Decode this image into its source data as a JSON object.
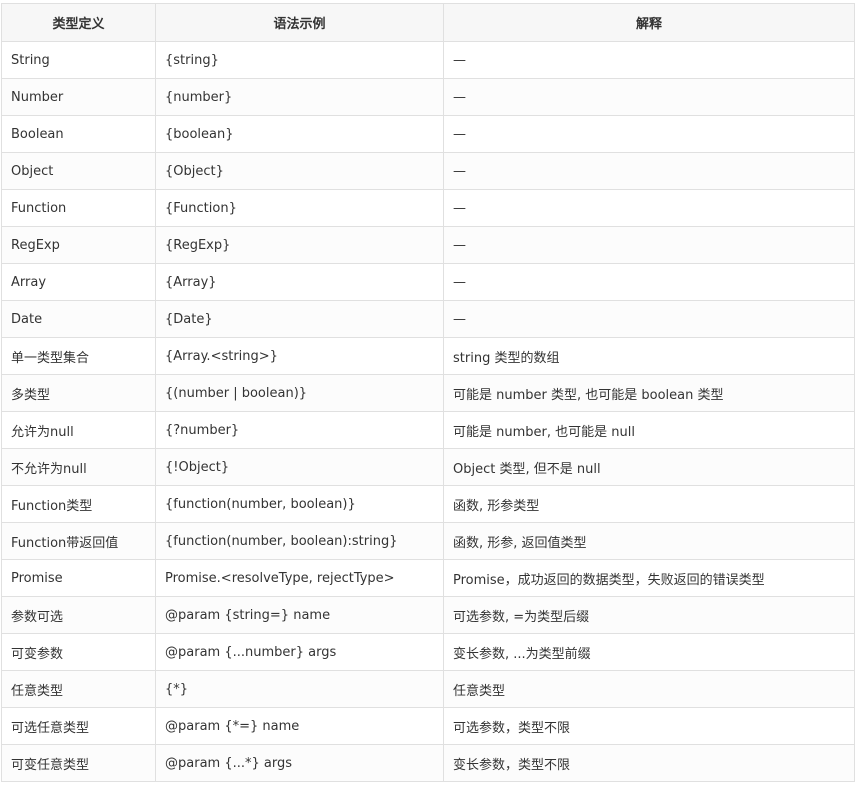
{
  "table": {
    "headers": [
      "类型定义",
      "语法示例",
      "解释"
    ],
    "rows": [
      [
        "String",
        "{string}",
        "—"
      ],
      [
        "Number",
        "{number}",
        "—"
      ],
      [
        "Boolean",
        "{boolean}",
        "—"
      ],
      [
        "Object",
        "{Object}",
        "—"
      ],
      [
        "Function",
        "{Function}",
        "—"
      ],
      [
        "RegExp",
        "{RegExp}",
        "—"
      ],
      [
        "Array",
        "{Array}",
        "—"
      ],
      [
        "Date",
        "{Date}",
        "—"
      ],
      [
        "单一类型集合",
        "{Array.<string>}",
        "string 类型的数组"
      ],
      [
        "多类型",
        "{(number | boolean)}",
        "可能是 number 类型, 也可能是 boolean 类型"
      ],
      [
        "允许为null",
        "{?number}",
        "可能是 number, 也可能是 null"
      ],
      [
        "不允许为null",
        "{!Object}",
        "Object 类型, 但不是 null"
      ],
      [
        "Function类型",
        "{function(number, boolean)}",
        "函数, 形参类型"
      ],
      [
        "Function带返回值",
        "{function(number, boolean):string}",
        "函数, 形参, 返回值类型"
      ],
      [
        "Promise",
        "Promise.<resolveType, rejectType>",
        "Promise，成功返回的数据类型，失败返回的错误类型"
      ],
      [
        "参数可选",
        "@param {string=} name",
        "可选参数, =为类型后缀"
      ],
      [
        "可变参数",
        "@param {...number} args",
        "变长参数, ...为类型前缀"
      ],
      [
        "任意类型",
        "{*}",
        "任意类型"
      ],
      [
        "可选任意类型",
        "@param {*=} name",
        "可选参数，类型不限"
      ],
      [
        "可变任意类型",
        "@param {...*} args",
        "变长参数，类型不限"
      ]
    ]
  }
}
